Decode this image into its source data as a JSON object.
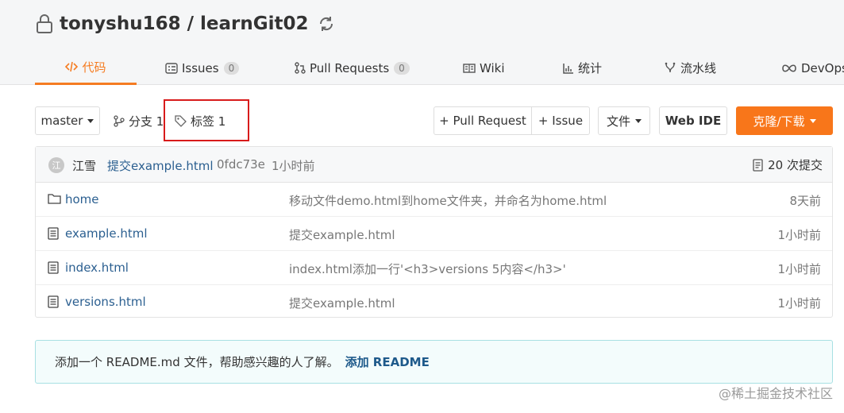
{
  "repo": {
    "title": "tonyshu168 / learnGit02"
  },
  "tabs": [
    {
      "label": "代码"
    },
    {
      "label": "Issues",
      "count": "0"
    },
    {
      "label": "Pull Requests",
      "count": "0"
    },
    {
      "label": "Wiki"
    },
    {
      "label": "统计"
    },
    {
      "label": "流水线"
    },
    {
      "label": "DevOps"
    }
  ],
  "toolbar": {
    "branch": "master",
    "branches_label": "分支 1",
    "tags_label": "标签 1",
    "pull_request": "+ Pull Request",
    "issue": "+ Issue",
    "file": "文件",
    "web_ide": "Web IDE",
    "clone": "克隆/下载"
  },
  "commit": {
    "avatar_text": "江",
    "author": "江雪",
    "message": "提交example.html",
    "sha": "0fdc73e",
    "time": "1小时前",
    "count_label": "20 次提交"
  },
  "files": [
    {
      "type": "folder",
      "name": "home",
      "message": "移动文件demo.html到home文件夹，并命名为home.html",
      "time": "8天前"
    },
    {
      "type": "file",
      "name": "example.html",
      "message": "提交example.html",
      "time": "1小时前"
    },
    {
      "type": "file",
      "name": "index.html",
      "message": "index.html添加一行'<h3>versions 5内容</h3>'",
      "time": "1小时前"
    },
    {
      "type": "file",
      "name": "versions.html",
      "message": "提交example.html",
      "time": "1小时前"
    }
  ],
  "readme": {
    "text": "添加一个 README.md 文件，帮助感兴趣的人了解。",
    "link": "添加 README"
  },
  "watermark": "@稀土掘金技术社区",
  "colors": {
    "accent": "#f57c22",
    "link": "#2b5f90",
    "clone_button": "#f8761a"
  }
}
